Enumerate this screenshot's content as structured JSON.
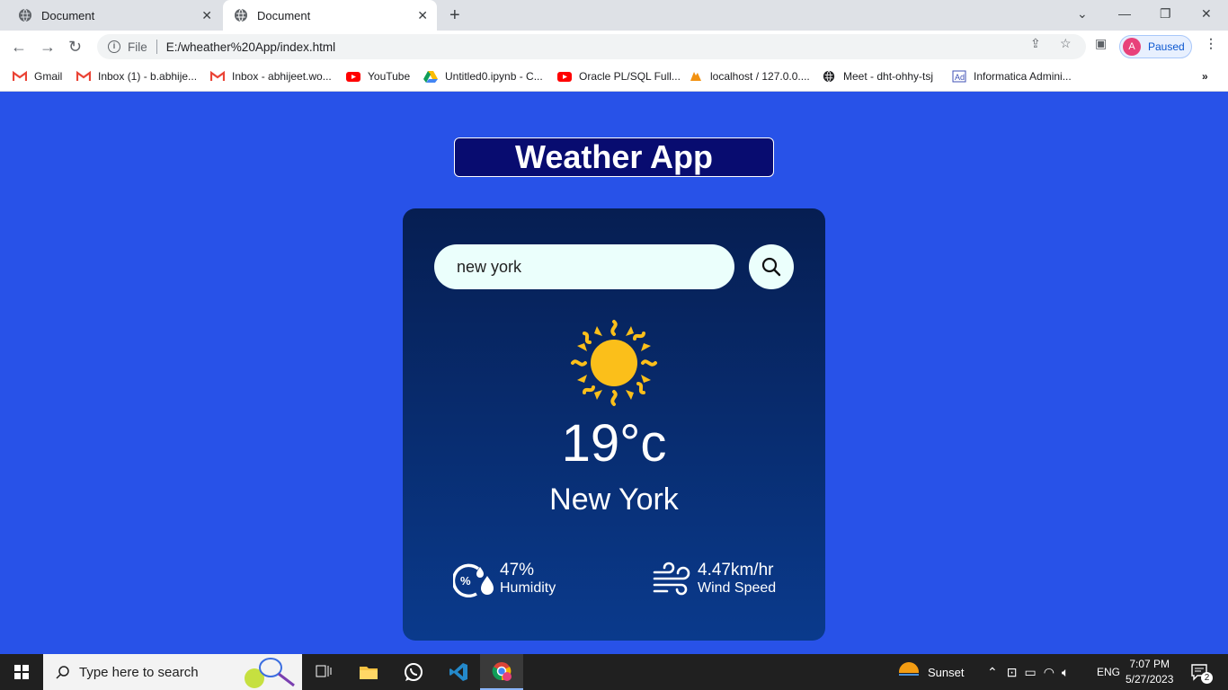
{
  "browser": {
    "tabs": [
      {
        "title": "Document"
      },
      {
        "title": "Document"
      }
    ],
    "address": {
      "scheme_label": "File",
      "url": "E:/wheather%20App/index.html"
    },
    "profile": {
      "initial": "A",
      "status": "Paused"
    },
    "bookmarks": [
      {
        "label": "Gmail",
        "icon": "gmail-icon"
      },
      {
        "label": "Inbox (1) - b.abhije...",
        "icon": "gmail-icon"
      },
      {
        "label": "Inbox - abhijeet.wo...",
        "icon": "gmail-icon"
      },
      {
        "label": "YouTube",
        "icon": "youtube-icon"
      },
      {
        "label": "Untitled0.ipynb - C...",
        "icon": "drive-icon"
      },
      {
        "label": "Oracle PL/SQL Full...",
        "icon": "youtube-icon"
      },
      {
        "label": "localhost / 127.0.0....",
        "icon": "phpmyadmin-icon"
      },
      {
        "label": "Meet - dht-ohhy-tsj",
        "icon": "globe-icon"
      },
      {
        "label": "Informatica Admini...",
        "icon": "informatica-icon"
      }
    ]
  },
  "app": {
    "title": "Weather App",
    "search": {
      "value": "new york"
    },
    "weather": {
      "icon": "sun-icon",
      "temperature": "19°c",
      "city": "New York"
    },
    "humidity": {
      "value": "47%",
      "label": "Humidity"
    },
    "wind": {
      "value": "4.47km/hr",
      "label": "Wind Speed"
    }
  },
  "taskbar": {
    "search_placeholder": "Type here to search",
    "weather_label": "Sunset",
    "language": "ENG",
    "time": "7:07 PM",
    "date": "5/27/2023",
    "notification_count": "2"
  },
  "colors": {
    "page_bg": "#2852e8",
    "title_bg": "#080c70",
    "card_top": "#061e52",
    "card_bottom": "#0a3a8c",
    "input_bg": "#ebfffc",
    "sun": "#fbbf1a"
  }
}
